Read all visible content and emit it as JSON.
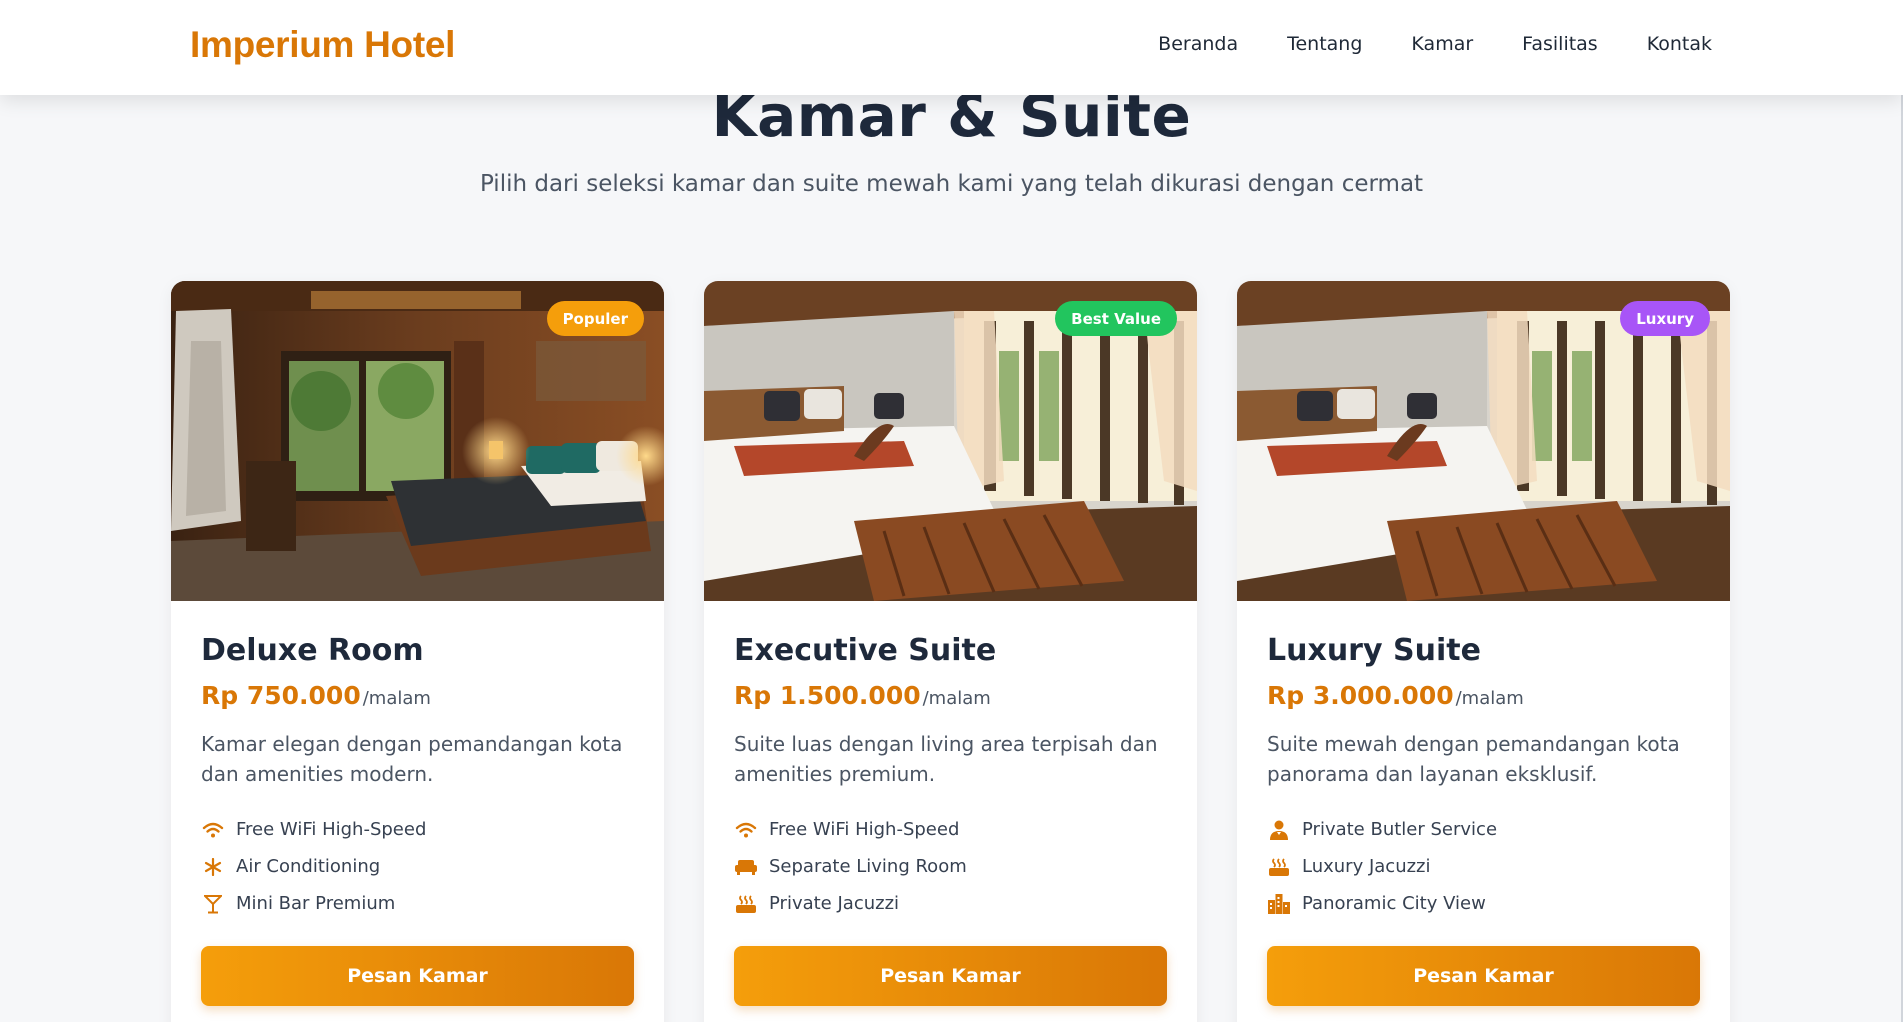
{
  "header": {
    "logo": "Imperium Hotel",
    "nav": [
      "Beranda",
      "Tentang",
      "Kamar",
      "Fasilitas",
      "Kontak"
    ]
  },
  "section": {
    "title": "Kamar & Suite",
    "subtitle": "Pilih dari seleksi kamar dan suite mewah kami yang telah dikurasi dengan cermat"
  },
  "colors": {
    "accent": "#d97706",
    "badge_populer": "#f59e0b",
    "badge_best_value": "#22c55e",
    "badge_luxury": "#a855f7"
  },
  "rooms": [
    {
      "badge": "Populer",
      "title": "Deluxe Room",
      "price": "Rp 750.000",
      "per": "/malam",
      "description": "Kamar elegan dengan pemandangan kota dan amenities modern.",
      "features": [
        {
          "icon": "wifi-icon",
          "label": "Free WiFi High-Speed"
        },
        {
          "icon": "snowflake-icon",
          "label": "Air Conditioning"
        },
        {
          "icon": "cocktail-icon",
          "label": "Mini Bar Premium"
        }
      ],
      "button": "Pesan Kamar"
    },
    {
      "badge": "Best Value",
      "title": "Executive Suite",
      "price": "Rp 1.500.000",
      "per": "/malam",
      "description": "Suite luas dengan living area terpisah dan amenities premium.",
      "features": [
        {
          "icon": "wifi-icon",
          "label": "Free WiFi High-Speed"
        },
        {
          "icon": "sofa-icon",
          "label": "Separate Living Room"
        },
        {
          "icon": "hot-tub-icon",
          "label": "Private Jacuzzi"
        }
      ],
      "button": "Pesan Kamar"
    },
    {
      "badge": "Luxury",
      "title": "Luxury Suite",
      "price": "Rp 3.000.000",
      "per": "/malam",
      "description": "Suite mewah dengan pemandangan kota panorama dan layanan eksklusif.",
      "features": [
        {
          "icon": "butler-icon",
          "label": "Private Butler Service"
        },
        {
          "icon": "hot-tub-icon",
          "label": "Luxury Jacuzzi"
        },
        {
          "icon": "city-icon",
          "label": "Panoramic City View"
        }
      ],
      "button": "Pesan Kamar"
    }
  ]
}
